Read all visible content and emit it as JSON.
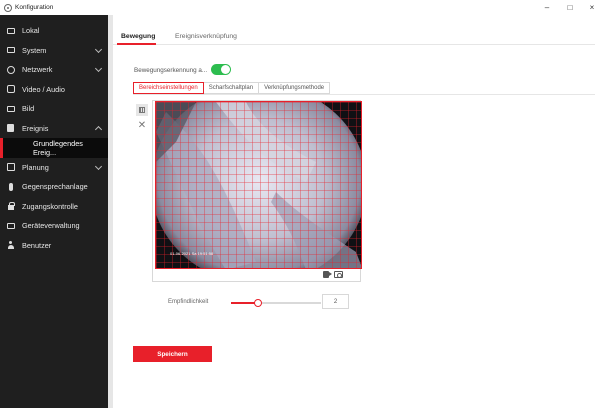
{
  "window": {
    "title": "Konfiguration",
    "controls": [
      "–",
      "□",
      "×"
    ]
  },
  "sidebar": {
    "items": [
      {
        "label": "Lokal",
        "icon": "monitor-icon"
      },
      {
        "label": "System",
        "icon": "system-icon",
        "expandable": true
      },
      {
        "label": "Netzwerk",
        "icon": "globe-icon",
        "expandable": true
      },
      {
        "label": "Video / Audio",
        "icon": "video-audio-icon"
      },
      {
        "label": "Bild",
        "icon": "image-icon"
      },
      {
        "label": "Ereignis",
        "icon": "event-icon",
        "expandable": true,
        "expanded": true
      },
      {
        "label": "Grundlegendes Ereig...",
        "sub": true,
        "active": true
      },
      {
        "label": "Planung",
        "icon": "calendar-icon",
        "expandable": true
      },
      {
        "label": "Gegensprechanlage",
        "icon": "microphone-icon"
      },
      {
        "label": "Zugangskontrolle",
        "icon": "lock-icon"
      },
      {
        "label": "Geräteverwaltung",
        "icon": "device-icon"
      },
      {
        "label": "Benutzer",
        "icon": "user-icon"
      }
    ]
  },
  "tabs": [
    {
      "label": "Bewegung",
      "active": true
    },
    {
      "label": "Ereignisverknüpfung",
      "active": false
    }
  ],
  "motion": {
    "label": "Bewegungserkennung a...",
    "enabled": true
  },
  "subtabs": [
    {
      "label": "Bereichseinstellungen",
      "active": true
    },
    {
      "label": "Scharfschaltplan",
      "active": false
    },
    {
      "label": "Verknüpfungsmethode",
      "active": false
    }
  ],
  "video": {
    "timestamp": "01-06-2021 Sa 19:51:58",
    "tools": [
      "video-record-icon",
      "snapshot-icon"
    ]
  },
  "sensitivity": {
    "label": "Empfindlichkeit",
    "value": "2",
    "level_fraction": 0.3
  },
  "save_label": "Speichern",
  "colors": {
    "accent": "#e8202a",
    "toggle_on": "#2dbd4f",
    "sidebar_bg": "#1f1f1f"
  }
}
